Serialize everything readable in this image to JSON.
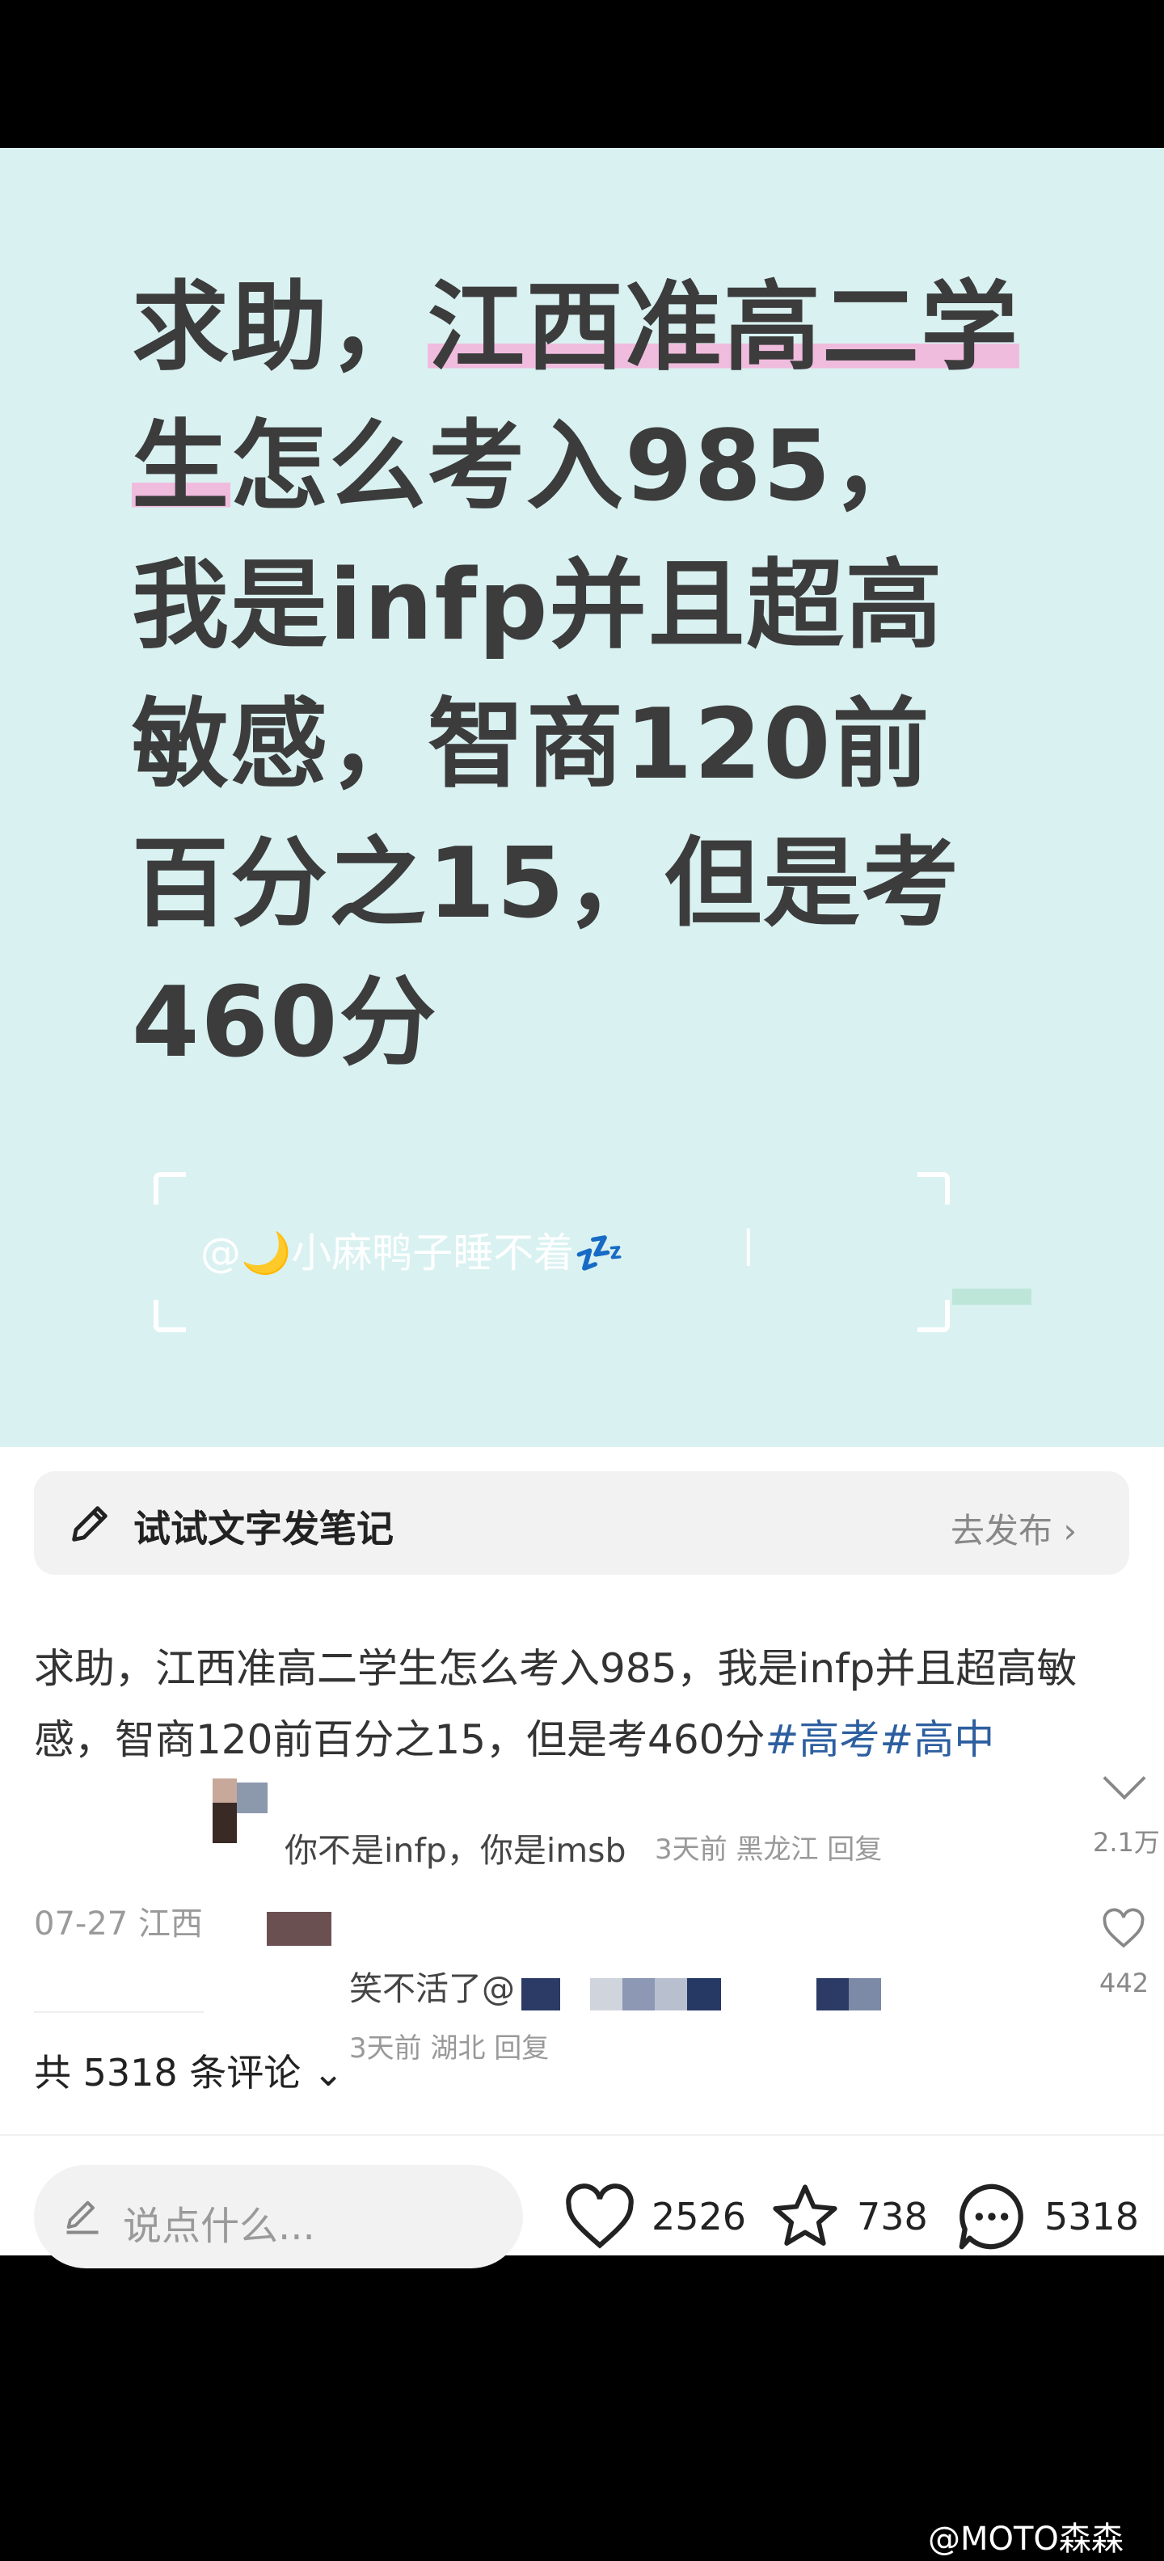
{
  "cover": {
    "title_before": "求助，",
    "title_highlight": "江西准高二学生",
    "title_after": "怎么考入985，我是infp并且超高敏感，智商120前百分之15，但是考460分",
    "credit": "@🌙小麻鸭子睡不着💤",
    "credit_sep": "|"
  },
  "publish_bar": {
    "text": "试试文字发笔记",
    "cta": "去发布 ›"
  },
  "post": {
    "caption": "求助，江西准高二学生怎么考入985，我是infp并且超高敏感，智商120前百分之15，但是考460分",
    "tags": [
      "#高考",
      "#高中"
    ],
    "date_location": "07-27  江西",
    "comment_count": "共 5318 条评论 ⌄"
  },
  "overlay_comments": [
    {
      "text": "你不是infp，你是imsb",
      "meta": "3天前  黑龙江  回复"
    },
    {
      "text": "笑不活了@",
      "meta": "3天前  湖北  回复"
    }
  ],
  "side_actions": {
    "fold_count": "2.1万",
    "like_count": "442"
  },
  "bottom_bar": {
    "input_placeholder": "说点什么...",
    "likes": "2526",
    "stars": "738",
    "comments": "5318"
  },
  "watermark": "@MOTO森森",
  "colors": {
    "cover_bg": "#d9f1f1",
    "highlight": "#f0bcde",
    "tag": "#2d5fa0"
  }
}
